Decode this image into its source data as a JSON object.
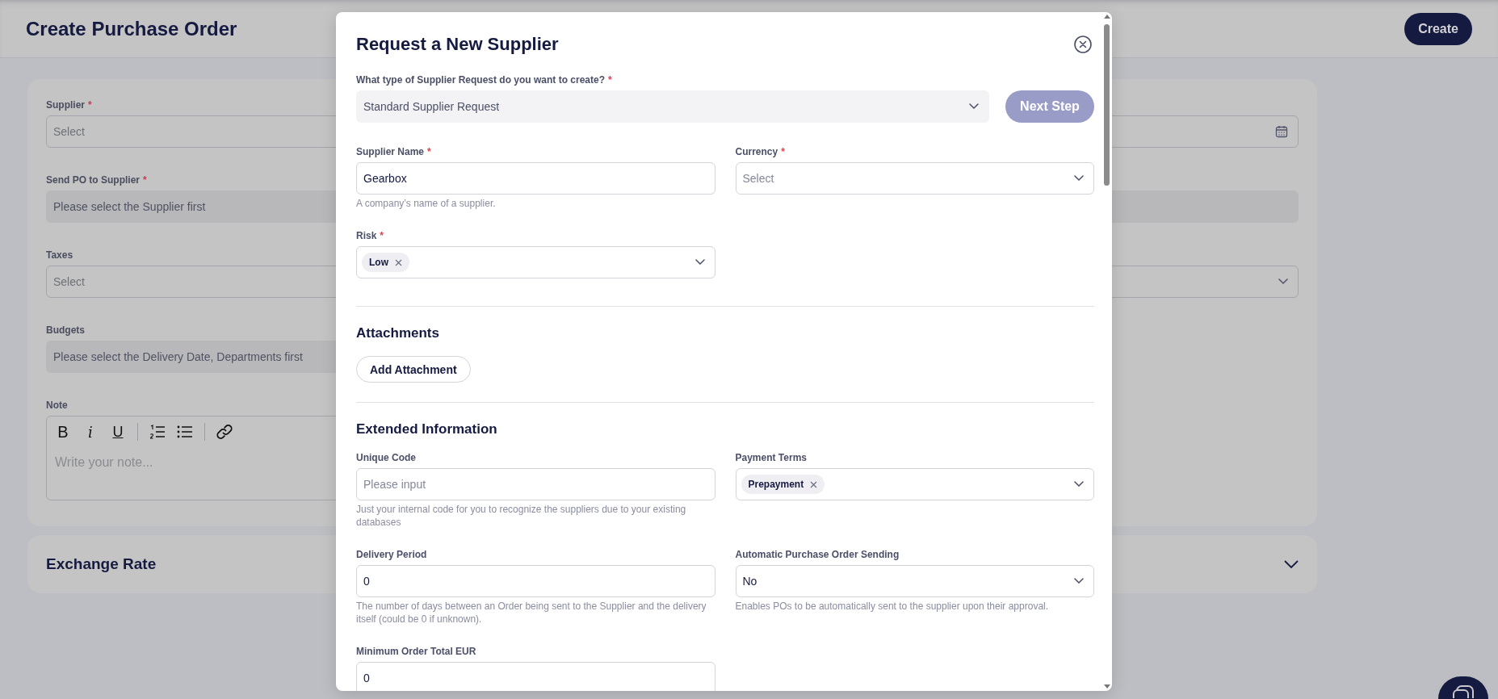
{
  "page": {
    "title": "Create Purchase Order",
    "create_button": "Create"
  },
  "form_card": {
    "rows": [
      {
        "cells": [
          {
            "label": "Supplier",
            "required_mark": "*",
            "kind": "select",
            "placeholder": "Select"
          },
          {
            "kind": "date"
          }
        ]
      },
      {
        "cells": [
          {
            "label": "Send PO to Supplier",
            "required_mark": "*",
            "kind": "readonly",
            "placeholder": "Please select the Supplier first"
          },
          {
            "kind": "readonly"
          }
        ]
      },
      {
        "cells": [
          {
            "label": "Taxes",
            "kind": "select",
            "placeholder": "Select"
          },
          {
            "kind": "select"
          }
        ]
      },
      {
        "cells": [
          {
            "label": "Budgets",
            "kind": "readonly",
            "placeholder": "Please select the Delivery Date, Departments first"
          }
        ]
      },
      {
        "cells": [
          {
            "label": "Note",
            "kind": "editor",
            "placeholder": "Write your note...",
            "toolbar": [
              {
                "kind": "bold",
                "label": "B"
              },
              {
                "kind": "italic",
                "label": "i"
              },
              {
                "kind": "underline",
                "label": "U"
              },
              {
                "kind": "divider"
              },
              {
                "kind": "ordered-list"
              },
              {
                "kind": "bullet-list"
              },
              {
                "kind": "divider"
              },
              {
                "kind": "link"
              }
            ]
          }
        ]
      }
    ]
  },
  "exchange_rate": {
    "title": "Exchange Rate",
    "expanded": false
  },
  "modal": {
    "title": "Request a New Supplier",
    "type_field": {
      "label": "What type of Supplier Request do you want to create?",
      "required_mark": "*",
      "kind": "filled-select",
      "value": "Standard Supplier Request"
    },
    "next_button": {
      "label": "Next Step",
      "disabled": true
    },
    "fields": [
      {
        "label": "Supplier Name",
        "required_mark": "*",
        "kind": "input",
        "value": "Gearbox",
        "help": "A company’s name of a supplier."
      },
      {
        "label": "Currency",
        "required_mark": "*",
        "kind": "select",
        "placeholder": "Select"
      },
      {
        "label": "Risk",
        "required_mark": "*",
        "kind": "tags",
        "tags": [
          "Low"
        ]
      }
    ],
    "sections": [
      {
        "title": "Attachments",
        "button": "Add Attachment"
      },
      {
        "title": "Extended Information",
        "fields": [
          {
            "label": "Unique Code",
            "kind": "input",
            "placeholder": "Please input",
            "help": "Just your internal code for you to recognize the suppliers due to your existing databases"
          },
          {
            "label": "Payment Terms",
            "kind": "tags",
            "tags": [
              "Prepayment"
            ]
          },
          {
            "label": "Delivery Period",
            "kind": "input",
            "value": "0",
            "help": "The number of days between an Order being sent to the Supplier and the delivery itself (could be 0 if unknown)."
          },
          {
            "label": "Automatic Purchase Order Sending",
            "kind": "select",
            "value": "No",
            "help": "Enables POs to be automatically sent to the supplier upon their approval."
          },
          {
            "label": "Minimum Order Total EUR",
            "kind": "input",
            "value": "0"
          }
        ]
      }
    ]
  }
}
